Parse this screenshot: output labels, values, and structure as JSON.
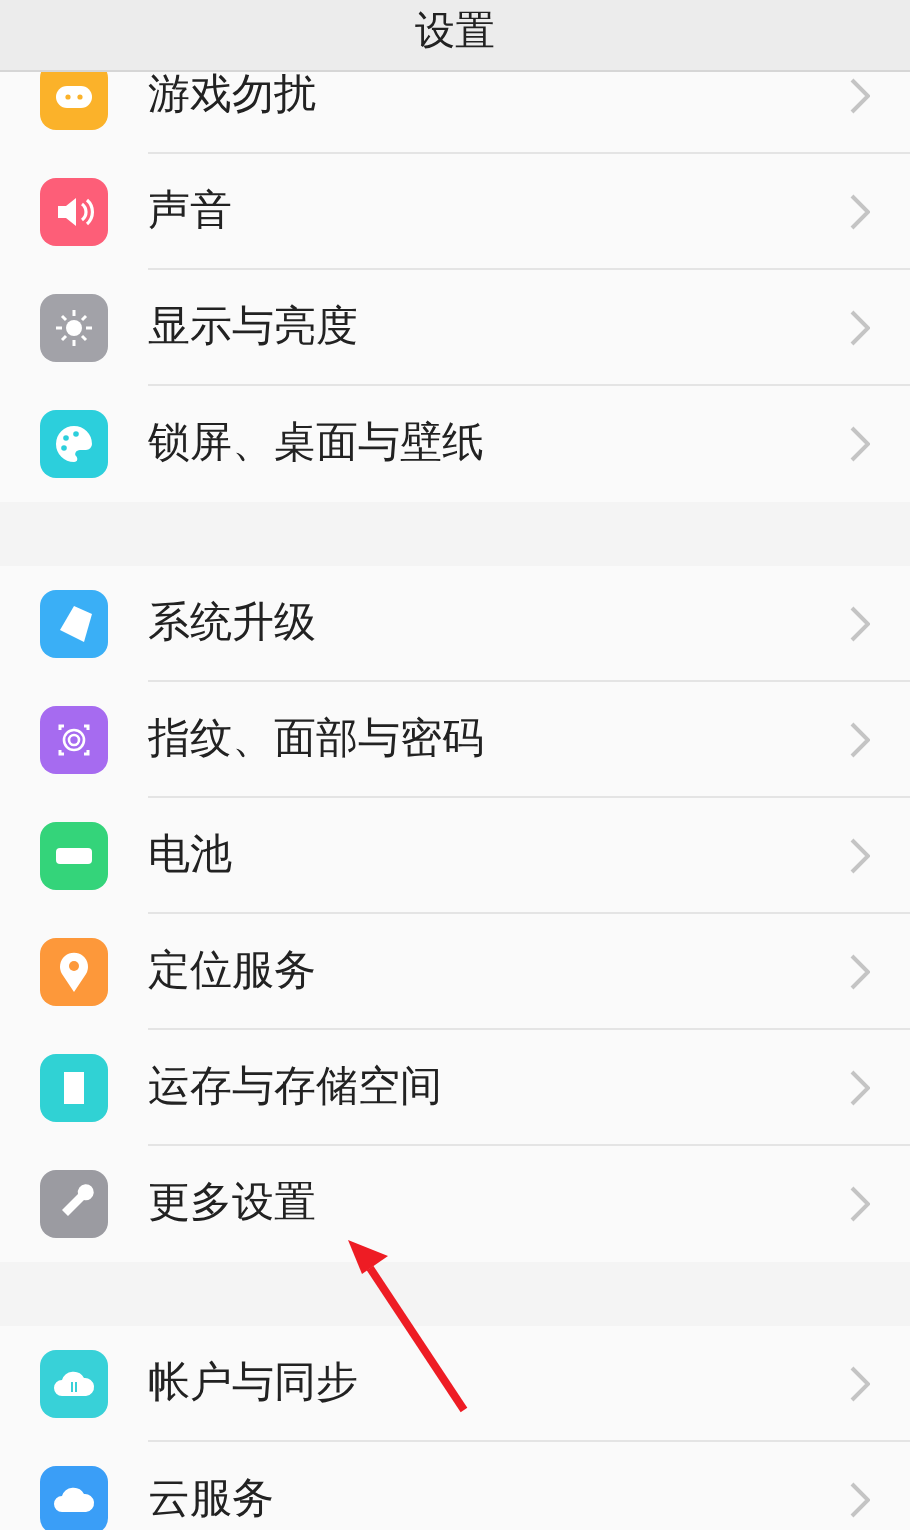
{
  "header": {
    "title": "设置"
  },
  "groups": [
    {
      "items": [
        {
          "label": "游戏勿扰",
          "color": "#fbb22a"
        },
        {
          "label": "声音",
          "color": "#fd5e78"
        },
        {
          "label": "显示与亮度",
          "color": "#a2a2a8"
        },
        {
          "label": "锁屏、桌面与壁纸",
          "color": "#2ccfdc"
        }
      ]
    },
    {
      "items": [
        {
          "label": "系统升级",
          "color": "#3aaff6"
        },
        {
          "label": "指纹、面部与密码",
          "color": "#a66bf0"
        },
        {
          "label": "电池",
          "color": "#34d47a"
        },
        {
          "label": "定位服务",
          "color": "#fd983a"
        },
        {
          "label": "运存与存储空间",
          "color": "#30d2d4"
        },
        {
          "label": "更多设置",
          "color": "#9b9ba1"
        }
      ]
    },
    {
      "items": [
        {
          "label": "帐户与同步",
          "color": "#38d1d8"
        },
        {
          "label": "云服务",
          "color": "#3a9ef7"
        }
      ]
    }
  ]
}
